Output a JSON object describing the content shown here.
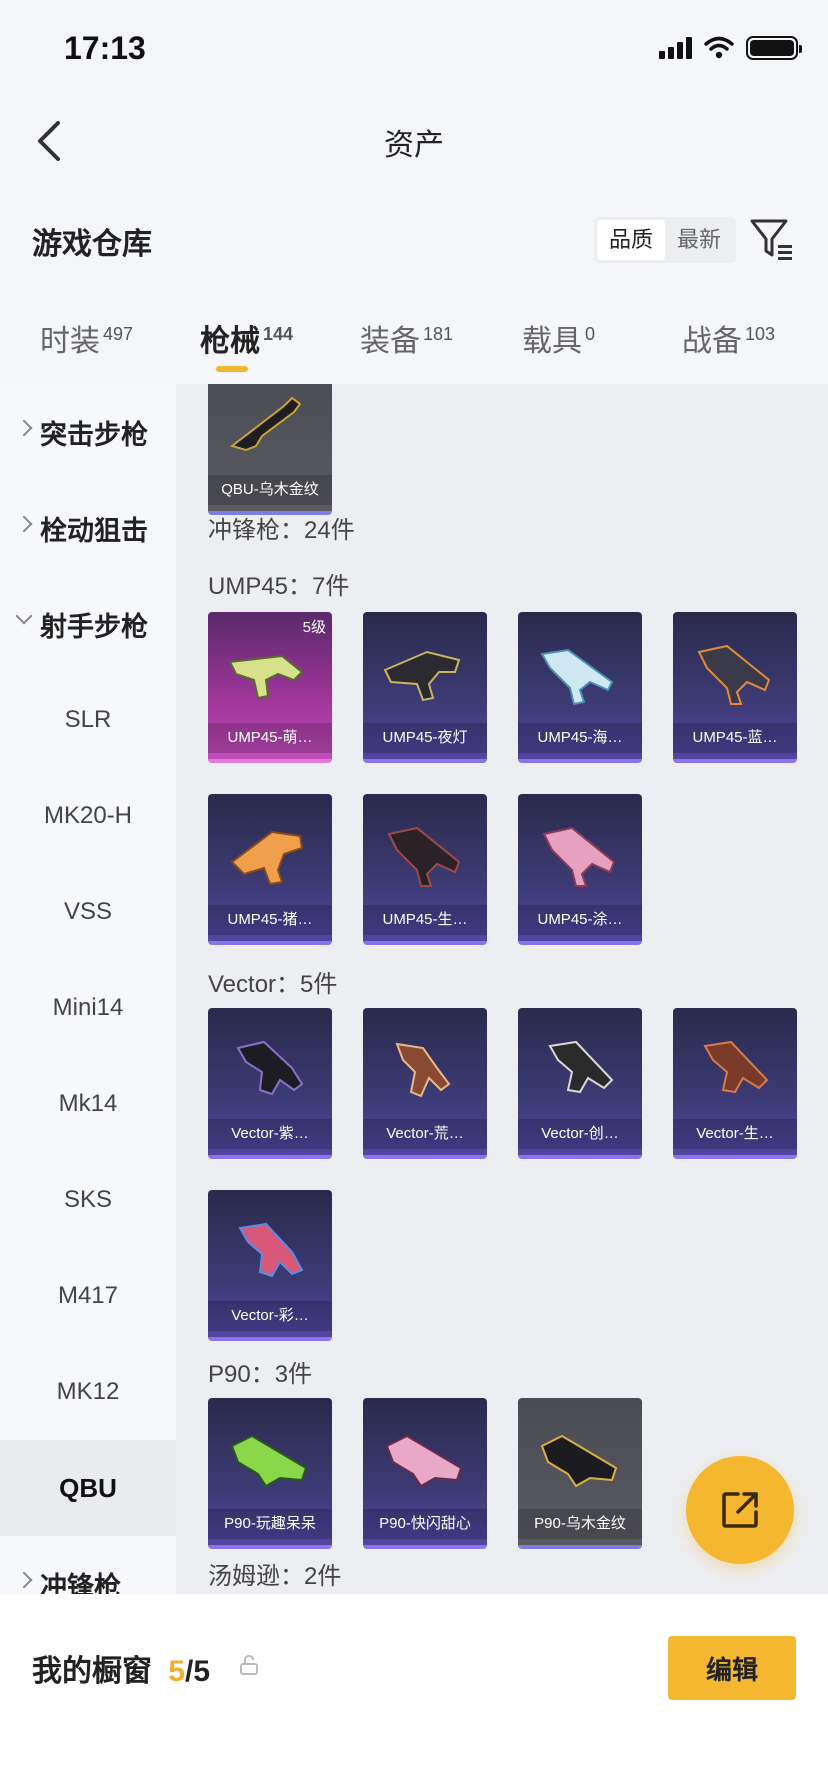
{
  "status": {
    "time": "17:13"
  },
  "nav": {
    "title": "资产"
  },
  "warehouse": {
    "title": "游戏仓库",
    "sort_quality": "品质",
    "sort_latest": "最新"
  },
  "tabs": [
    {
      "label": "时装",
      "count": "497"
    },
    {
      "label": "枪械",
      "count": "144"
    },
    {
      "label": "装备",
      "count": "181"
    },
    {
      "label": "载具",
      "count": "0"
    },
    {
      "label": "战备",
      "count": "103"
    }
  ],
  "sidebar": {
    "groups": [
      "突击步枪",
      "栓动狙击",
      "射手步枪",
      "冲锋枪"
    ],
    "subs": [
      "SLR",
      "MK20-H",
      "VSS",
      "Mini14",
      "Mk14",
      "SKS",
      "M417",
      "MK12",
      "QBU"
    ]
  },
  "content": {
    "top_card": "QBU-乌木金纹",
    "smg_header": "冲锋枪：24件",
    "ump_header": "UMP45：7件",
    "ump_badge": "5级",
    "ump": [
      "UMP45-萌…",
      "UMP45-夜灯",
      "UMP45-海…",
      "UMP45-蓝…",
      "UMP45-猪…",
      "UMP45-生…",
      "UMP45-涂…"
    ],
    "vector_header": "Vector：5件",
    "vector": [
      "Vector-紫…",
      "Vector-荒…",
      "Vector-创…",
      "Vector-生…",
      "Vector-彩…"
    ],
    "p90_header": "P90：3件",
    "p90": [
      "P90-玩趣呆呆",
      "P90-快闪甜心",
      "P90-乌木金纹"
    ],
    "tommy_header": "汤姆逊：2件"
  },
  "showcase": {
    "label": "我的橱窗",
    "count": "5",
    "total": "/5",
    "edit": "编辑"
  },
  "colors": {
    "accent": "#f5b730",
    "card_purple": "#3c3a73",
    "card_pink": "#a0369a"
  }
}
